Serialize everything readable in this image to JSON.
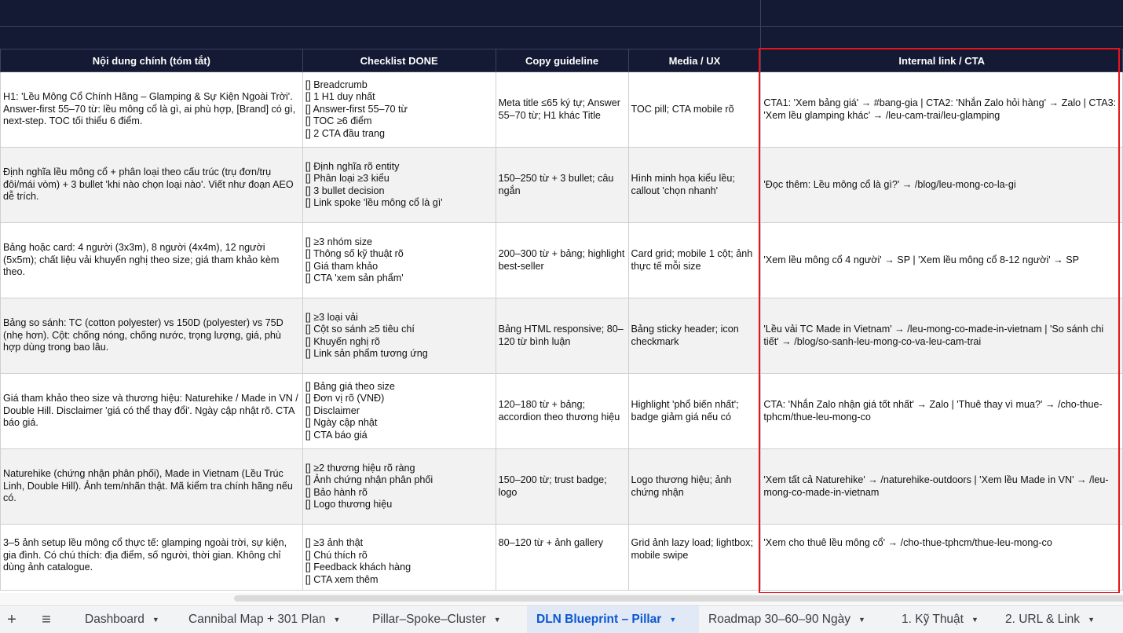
{
  "columns": [
    "Nội dung chính (tóm tắt)",
    "Checklist DONE",
    "Copy guideline",
    "Media / UX",
    "Internal link / CTA"
  ],
  "rows": [
    {
      "content": "H1: 'Lều Mông Cổ Chính Hãng – Glamping & Sự Kiện Ngoài Trời'. Answer-first 55–70 từ: lều mông cổ là gì, ai phù hợp, [Brand] có gì, next-step. TOC tối thiểu 6 điểm.",
      "checklist": [
        "[] Breadcrumb",
        "[] 1 H1 duy nhất",
        "[] Answer-first 55–70 từ",
        "[] TOC ≥6 điểm",
        "[] 2 CTA đầu trang"
      ],
      "copy": "Meta title ≤65 ký tự; Answer 55–70 từ; H1 khác Title",
      "media": "TOC pill; CTA mobile rõ",
      "link": "CTA1: 'Xem bảng giá' → #bang-gia | CTA2: 'Nhắn Zalo hỏi hàng' → Zalo | CTA3: 'Xem lều glamping khác' → /leu-cam-trai/leu-glamping"
    },
    {
      "content": "Định nghĩa lều mông cổ + phân loại theo cấu trúc (trụ đơn/trụ đôi/mái vòm) + 3 bullet 'khi nào chọn loại nào'. Viết như đoạn AEO dễ trích.",
      "checklist": [
        "[] Định nghĩa rõ entity",
        "[] Phân loại ≥3 kiểu",
        "[] 3 bullet decision",
        "[] Link spoke 'lều mông cổ là gì'"
      ],
      "copy": "150–250 từ + 3 bullet; câu ngắn",
      "media": "Hình minh họa kiểu lều; callout 'chọn nhanh'",
      "link": "'Đọc thêm: Lều mông cổ là gì?' → /blog/leu-mong-co-la-gi"
    },
    {
      "content": "Bảng hoặc card: 4 người (3x3m), 8 người (4x4m), 12 người (5x5m); chất liệu vải khuyến nghị theo size; giá tham khảo kèm theo.",
      "checklist": [
        "[] ≥3 nhóm size",
        "[] Thông số kỹ thuật rõ",
        "[] Giá tham khảo",
        "[] CTA 'xem sản phẩm'"
      ],
      "copy": "200–300 từ + bảng; highlight best-seller",
      "media": "Card grid; mobile 1 cột; ảnh thực tế mỗi size",
      "link": "'Xem lều mông cổ 4 người' → SP | 'Xem lều mông cổ 8-12 người' → SP"
    },
    {
      "content": "Bảng so sánh: TC (cotton polyester) vs 150D (polyester) vs 75D (nhẹ hơn). Cột: chống nóng, chống nước, trọng lượng, giá, phù hợp dùng trong bao lâu.",
      "checklist": [
        "[] ≥3 loại vải",
        "[] Cột so sánh ≥5 tiêu chí",
        "[] Khuyến nghị rõ",
        "[] Link sản phẩm tương ứng"
      ],
      "copy": "Bảng HTML responsive; 80–120 từ bình luận",
      "media": "Bảng sticky header; icon checkmark",
      "link": "'Lều vải TC Made in Vietnam' → /leu-mong-co-made-in-vietnam | 'So sánh chi tiết' → /blog/so-sanh-leu-mong-co-va-leu-cam-trai"
    },
    {
      "content": "Giá tham khảo theo size và thương hiệu: Naturehike / Made in VN / Double Hill. Disclaimer 'giá có thể thay đổi'. Ngày cập nhật rõ. CTA báo giá.",
      "checklist": [
        "[] Bảng giá theo size",
        "[] Đơn vị rõ (VNĐ)",
        "[] Disclaimer",
        "[] Ngày cập nhật",
        "[] CTA báo giá"
      ],
      "copy": "120–180 từ + bảng; accordion theo thương hiệu",
      "media": "Highlight 'phổ biến nhất'; badge giảm giá nếu có",
      "link": "CTA: 'Nhắn Zalo nhận giá tốt nhất' → Zalo | 'Thuê thay vì mua?' → /cho-thue-tphcm/thue-leu-mong-co"
    },
    {
      "content": "Naturehike (chứng nhận phân phối), Made in Vietnam (Lều Trúc Linh, Double Hill). Ảnh tem/nhãn thật. Mã kiểm tra chính hãng nếu có.",
      "checklist": [
        "[] ≥2 thương hiệu rõ ràng",
        "[] Ảnh chứng nhận phân phối",
        "[] Bảo hành rõ",
        "[] Logo thương hiệu"
      ],
      "copy": "150–200 từ; trust badge; logo",
      "media": "Logo thương hiệu; ảnh chứng nhận",
      "link": "'Xem tất cả Naturehike' → /naturehike-outdoors | 'Xem lều Made in VN' → /leu-mong-co-made-in-vietnam"
    },
    {
      "content": "3–5 ảnh setup lều mông cổ thực tế: glamping ngoài trời, sự kiện, gia đình. Có chú thích: địa điểm, số người, thời gian. Không chỉ dùng ảnh catalogue.",
      "checklist": [
        "[] ≥3 ảnh thật",
        "[] Chú thích rõ",
        "[] Feedback khách hàng",
        "[] CTA xem thêm"
      ],
      "copy": "80–120 từ + ảnh gallery",
      "media": "Grid ảnh lazy load; lightbox; mobile swipe",
      "link": "'Xem cho thuê lều mông cổ' → /cho-thue-tphcm/thue-leu-mong-co"
    }
  ],
  "tabs": [
    {
      "label": "Dashboard"
    },
    {
      "label": "Cannibal Map + 301 Plan"
    },
    {
      "label": "Pillar–Spoke–Cluster"
    },
    {
      "label": "DLN Blueprint – Pillar"
    },
    {
      "label": "Roadmap 30–60–90 Ngày"
    },
    {
      "label": "1. Kỹ Thuật"
    },
    {
      "label": "2. URL & Link"
    }
  ],
  "tabbar": {
    "add_icon": "+",
    "menu_icon": "≡",
    "active_tab": "DLN Blueprint – Pillar"
  },
  "colors": {
    "header_bg": "#141934",
    "highlight_border": "#e8141b",
    "active_tab": "#0b57d0",
    "alt_row": "#f2f2f2"
  }
}
